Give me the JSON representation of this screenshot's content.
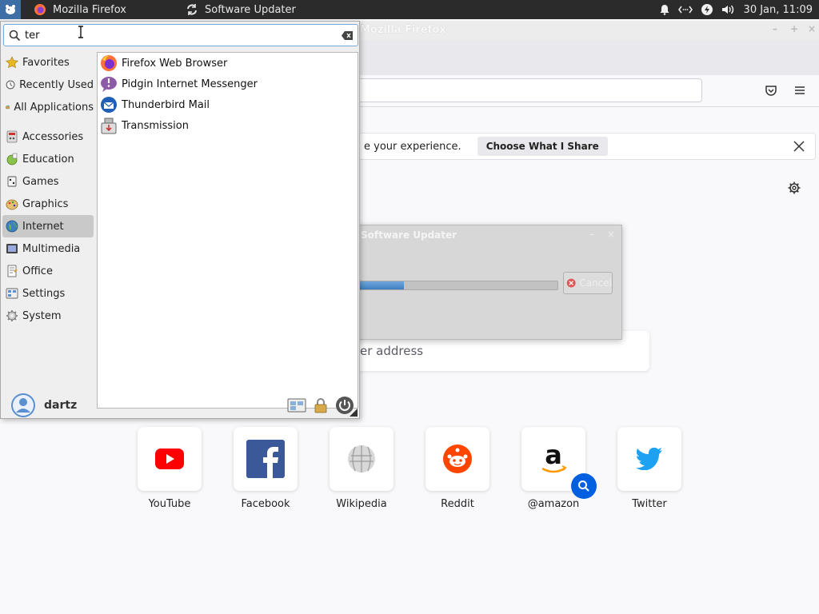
{
  "panel": {
    "tasks": [
      {
        "label": "Mozilla Firefox",
        "icon": "firefox-icon"
      },
      {
        "label": "Software Updater",
        "icon": "refresh-icon"
      }
    ],
    "clock": "30 Jan, 11:09"
  },
  "firefox": {
    "window_title": "Mozilla Firefox",
    "notification_text": "e your experience.",
    "notification_button": "Choose What I Share",
    "search_placeholder": "er address",
    "top_sites": [
      {
        "label": "YouTube",
        "icon": "youtube-icon"
      },
      {
        "label": "Facebook",
        "icon": "facebook-icon"
      },
      {
        "label": "Wikipedia",
        "icon": "wikipedia-icon"
      },
      {
        "label": "Reddit",
        "icon": "reddit-icon"
      },
      {
        "label": "@amazon",
        "icon": "amazon-icon"
      },
      {
        "label": "Twitter",
        "icon": "twitter-icon"
      }
    ]
  },
  "updater": {
    "title": "Software Updater",
    "progress": 0.23,
    "cancel_label": "Cancel"
  },
  "menu": {
    "search_value": "ter",
    "categories": [
      {
        "label": "Favorites",
        "icon": "star-icon"
      },
      {
        "label": "Recently Used",
        "icon": "clock-icon"
      },
      {
        "label": "All Applications",
        "icon": "apps-folder-icon"
      },
      {
        "label": "Accessories",
        "icon": "accessories-icon"
      },
      {
        "label": "Education",
        "icon": "education-icon"
      },
      {
        "label": "Games",
        "icon": "games-icon"
      },
      {
        "label": "Graphics",
        "icon": "graphics-icon"
      },
      {
        "label": "Internet",
        "icon": "globe-icon",
        "active": true
      },
      {
        "label": "Multimedia",
        "icon": "multimedia-icon"
      },
      {
        "label": "Office",
        "icon": "office-icon"
      },
      {
        "label": "Settings",
        "icon": "settings-icon"
      },
      {
        "label": "System",
        "icon": "system-gear-icon"
      }
    ],
    "apps": [
      {
        "label": "Firefox Web Browser",
        "icon": "firefox-icon"
      },
      {
        "label": "Pidgin Internet Messenger",
        "icon": "pidgin-icon"
      },
      {
        "label": "Thunderbird Mail",
        "icon": "thunderbird-icon"
      },
      {
        "label": "Transmission",
        "icon": "transmission-icon"
      }
    ],
    "username": "dartz"
  },
  "colors": {
    "panel_bg": "#2b2b2b",
    "accent": "#3d6fa6",
    "progress_fill": "#4f8ccb",
    "amazon_badge": "#0060df"
  }
}
